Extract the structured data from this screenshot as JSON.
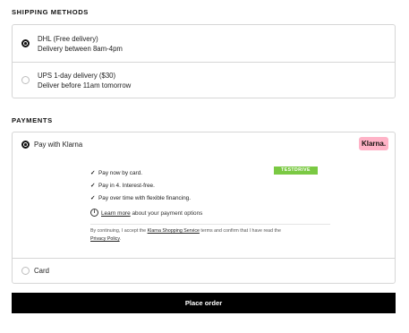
{
  "shipping": {
    "title": "SHIPPING METHODS",
    "options": [
      {
        "line1": "DHL (Free delivery)",
        "line2": "Delivery between 8am-4pm",
        "selected": true
      },
      {
        "line1": "UPS 1-day delivery ($30)",
        "line2": "Deliver before 11am tomorrow",
        "selected": false
      }
    ]
  },
  "payments": {
    "title": "PAYMENTS",
    "klarna": {
      "label": "Pay with Klarna",
      "badge": "Klarna.",
      "badge_color": "#ffb3c7",
      "test_badge": "TESTDRIVE",
      "test_badge_color": "#7ac943",
      "bullets": [
        "Pay now by card.",
        "Pay in 4. Interest-free.",
        "Pay over time with flexible financing."
      ],
      "check_icon": "✓",
      "info_icon": "i",
      "learn_more_link": "Learn more",
      "learn_more_rest": " about your payment options",
      "terms_prefix": "By continuing, I accept the ",
      "terms_link": "Klarna Shopping Service",
      "terms_middle": " terms and confirm that I have read the",
      "privacy_link": "Privacy Policy",
      "terms_suffix": "."
    },
    "card": {
      "label": "Card"
    }
  },
  "place_order": "Place order"
}
